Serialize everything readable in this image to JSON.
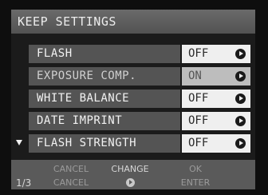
{
  "title": "KEEP SETTINGS",
  "rows": [
    {
      "label": "FLASH",
      "value": "OFF",
      "dim": false,
      "arrow_icon": "right-arrow-circle-icon"
    },
    {
      "label": "EXPOSURE COMP.",
      "value": "ON",
      "dim": true,
      "arrow_icon": "right-arrow-circle-icon"
    },
    {
      "label": "WHITE BALANCE",
      "value": "OFF",
      "dim": false,
      "arrow_icon": "right-arrow-circle-icon"
    },
    {
      "label": "DATE IMPRINT",
      "value": "OFF",
      "dim": false,
      "arrow_icon": "right-arrow-circle-icon"
    },
    {
      "label": "FLASH STRENGTH",
      "value": "OFF",
      "dim": false,
      "arrow_icon": "right-arrow-circle-icon"
    }
  ],
  "scroll_indicator_icon": "down-triangle-icon",
  "footer": {
    "page": "1/3",
    "top": {
      "cancel": "CANCEL",
      "change": "CHANGE",
      "ok": "OK"
    },
    "bottom": {
      "cancel": "CANCEL",
      "change_icon": "right-arrow-circle-icon",
      "ok": "ENTER"
    }
  },
  "colors": {
    "title_bar": "#5e5e5e",
    "row_label_bg": "#545454",
    "row_value_bg": "#efefef",
    "footer_bg": "#5a5a5a"
  }
}
